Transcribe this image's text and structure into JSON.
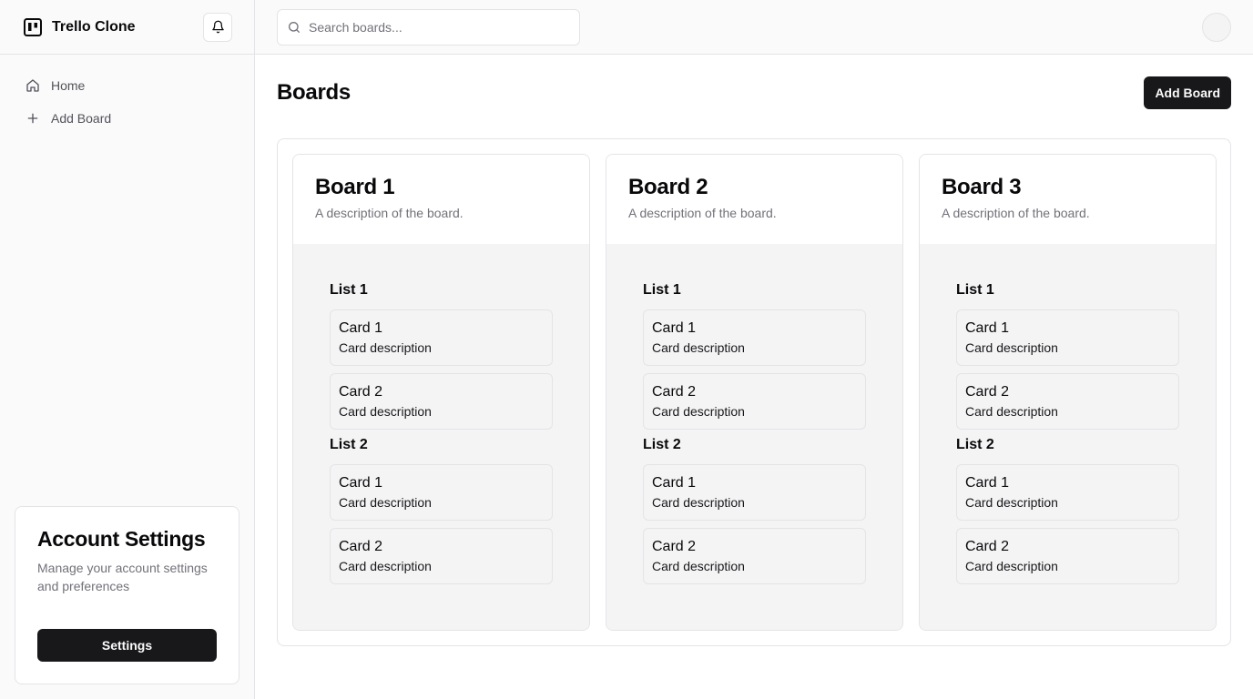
{
  "app": {
    "title": "Trello Clone"
  },
  "sidebar": {
    "items": [
      {
        "label": "Home",
        "icon": "home-icon"
      },
      {
        "label": "Add Board",
        "icon": "plus-icon"
      }
    ],
    "account": {
      "title": "Account Settings",
      "description": "Manage your account settings and preferences",
      "button_label": "Settings"
    }
  },
  "topbar": {
    "search_placeholder": "Search boards..."
  },
  "main": {
    "title": "Boards",
    "add_button_label": "Add Board",
    "boards": [
      {
        "title": "Board 1",
        "description": "A description of the board.",
        "lists": [
          {
            "title": "List 1",
            "cards": [
              {
                "title": "Card 1",
                "description": "Card description"
              },
              {
                "title": "Card 2",
                "description": "Card description"
              }
            ]
          },
          {
            "title": "List 2",
            "cards": [
              {
                "title": "Card 1",
                "description": "Card description"
              },
              {
                "title": "Card 2",
                "description": "Card description"
              }
            ]
          }
        ]
      },
      {
        "title": "Board 2",
        "description": "A description of the board.",
        "lists": [
          {
            "title": "List 1",
            "cards": [
              {
                "title": "Card 1",
                "description": "Card description"
              },
              {
                "title": "Card 2",
                "description": "Card description"
              }
            ]
          },
          {
            "title": "List 2",
            "cards": [
              {
                "title": "Card 1",
                "description": "Card description"
              },
              {
                "title": "Card 2",
                "description": "Card description"
              }
            ]
          }
        ]
      },
      {
        "title": "Board 3",
        "description": "A description of the board.",
        "lists": [
          {
            "title": "List 1",
            "cards": [
              {
                "title": "Card 1",
                "description": "Card description"
              },
              {
                "title": "Card 2",
                "description": "Card description"
              }
            ]
          },
          {
            "title": "List 2",
            "cards": [
              {
                "title": "Card 1",
                "description": "Card description"
              },
              {
                "title": "Card 2",
                "description": "Card description"
              }
            ]
          }
        ]
      }
    ]
  },
  "colors": {
    "primary": "#18181b",
    "muted_text": "#71717a",
    "border": "#e4e4e7",
    "surface": "#f4f4f5"
  }
}
